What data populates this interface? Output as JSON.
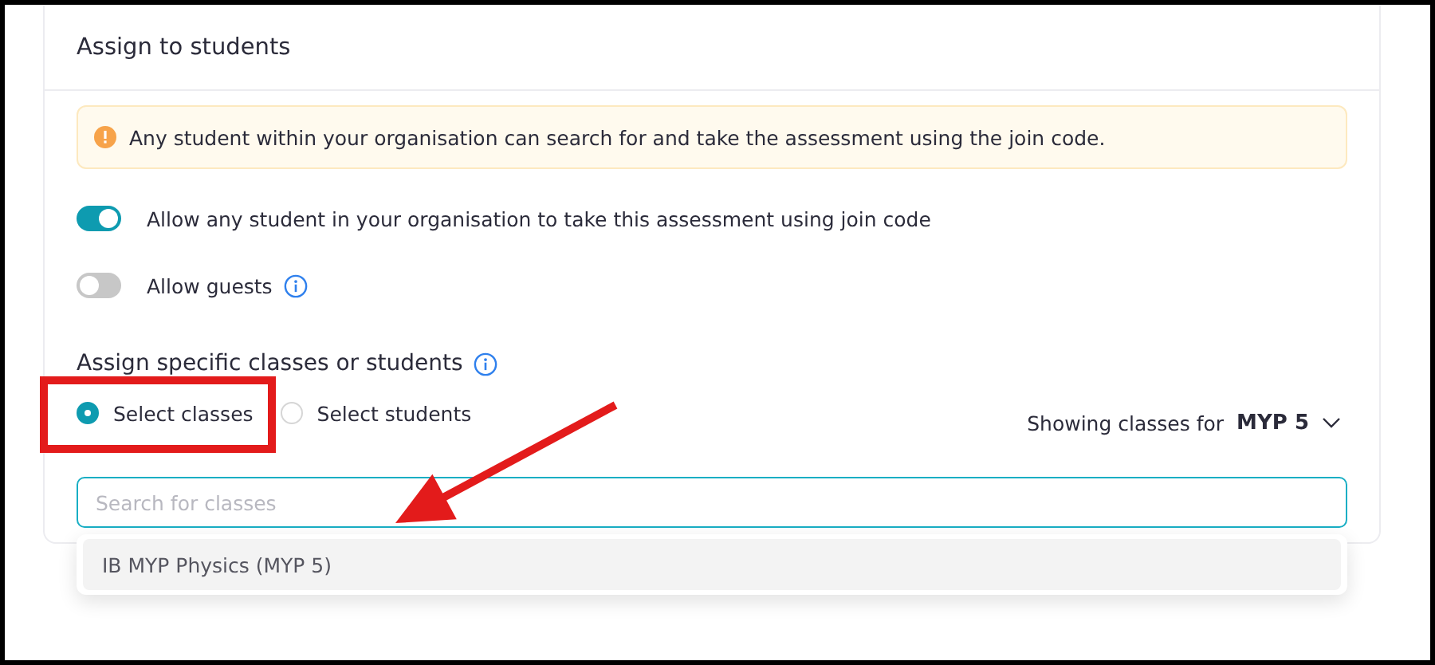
{
  "card": {
    "title": "Assign to students"
  },
  "notice": {
    "text": "Any student within your organisation can search for and take the assessment using the join code."
  },
  "toggles": [
    {
      "label": "Allow any student in your organisation to take this assessment using join code",
      "on": true,
      "info": false
    },
    {
      "label": "Allow guests",
      "on": false,
      "info": true
    }
  ],
  "section": {
    "title": "Assign specific classes or students",
    "info": true
  },
  "radios": [
    {
      "label": "Select classes",
      "selected": true
    },
    {
      "label": "Select students",
      "selected": false
    }
  ],
  "grade_filter": {
    "label": "Showing classes for",
    "value": "MYP 5"
  },
  "search": {
    "placeholder": "Search for classes",
    "focused": true
  },
  "dropdown": {
    "items": [
      {
        "label": "IB MYP Physics (MYP 5)",
        "selected": true
      }
    ]
  }
}
